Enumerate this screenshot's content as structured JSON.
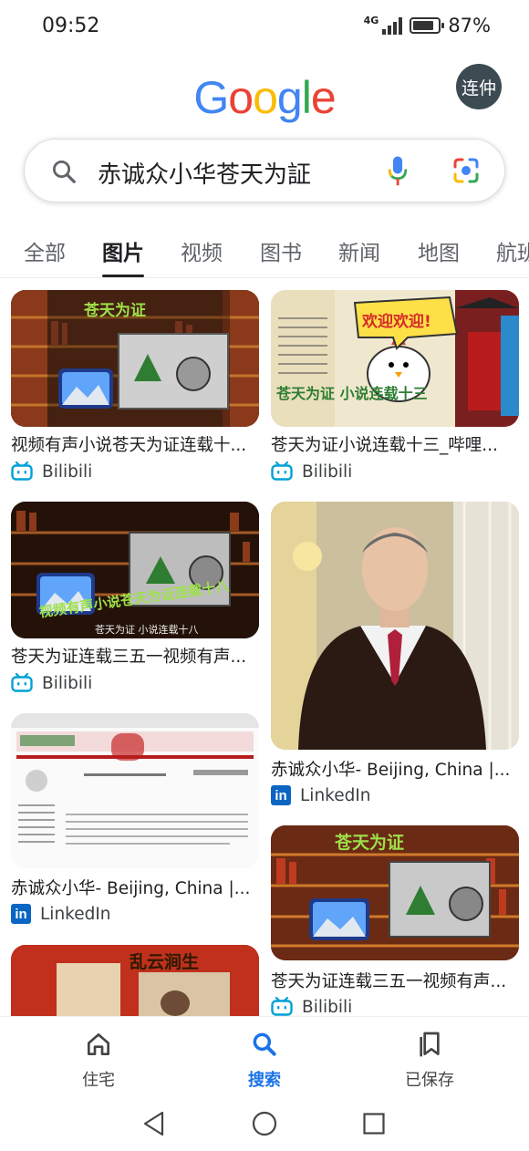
{
  "status": {
    "time": "09:52",
    "network": "4G",
    "battery": "87%",
    "battery_level": 0.87
  },
  "header": {
    "logo": [
      "G",
      "o",
      "o",
      "g",
      "l",
      "e"
    ],
    "logo_colors": [
      "#4285F4",
      "#EA4335",
      "#FBBC05",
      "#4285F4",
      "#34A853",
      "#EA4335"
    ],
    "avatar_text": "连仲"
  },
  "search": {
    "query": "赤诚众小华苍天为証"
  },
  "tabs": [
    {
      "label": "全部",
      "active": false
    },
    {
      "label": "图片",
      "active": true
    },
    {
      "label": "视频",
      "active": false
    },
    {
      "label": "图书",
      "active": false
    },
    {
      "label": "新闻",
      "active": false
    },
    {
      "label": "地图",
      "active": false
    },
    {
      "label": "航班",
      "active": false
    }
  ],
  "results": [
    {
      "caption": "视频有声小说苍天为证连载十...",
      "source": "Bilibili",
      "source_icon": "bilibili-icon"
    },
    {
      "caption": "苍天为证小说连载十三_哔哩...",
      "source": "Bilibili",
      "source_icon": "bilibili-icon"
    },
    {
      "caption": "苍天为证连载三五一视频有声...",
      "source": "Bilibili",
      "source_icon": "bilibili-icon"
    },
    {
      "caption": "赤诚众小华- Beijing, China |...",
      "source": "LinkedIn",
      "source_icon": "linkedin-icon"
    },
    {
      "caption": "赤诚众小华- Beijing, China |...",
      "source": "LinkedIn",
      "source_icon": "linkedin-icon"
    },
    {
      "caption": "苍天为证连载三五一视频有声...",
      "source": "Bilibili",
      "source_icon": "bilibili-icon"
    }
  ],
  "image_texts": {
    "r1": "苍天为证",
    "r2_banner": "欢迎欢迎!",
    "r2_title": "苍天为证 小说连载十三",
    "r3_title": "视频有声小说苍天为证连载十八",
    "r3_sub": "苍天为证 小说连载十八",
    "r6": "苍天为证",
    "r7": "乱云涧生"
  },
  "bottom_nav": [
    {
      "label": "住宅",
      "icon": "home-icon",
      "active": false
    },
    {
      "label": "搜索",
      "icon": "search-icon",
      "active": true
    },
    {
      "label": "已保存",
      "icon": "bookmark-icon",
      "active": false
    }
  ],
  "colors": {
    "accent": "#1a73e8",
    "bilibili": "#00a1d6",
    "linkedin": "#0a66c2"
  }
}
